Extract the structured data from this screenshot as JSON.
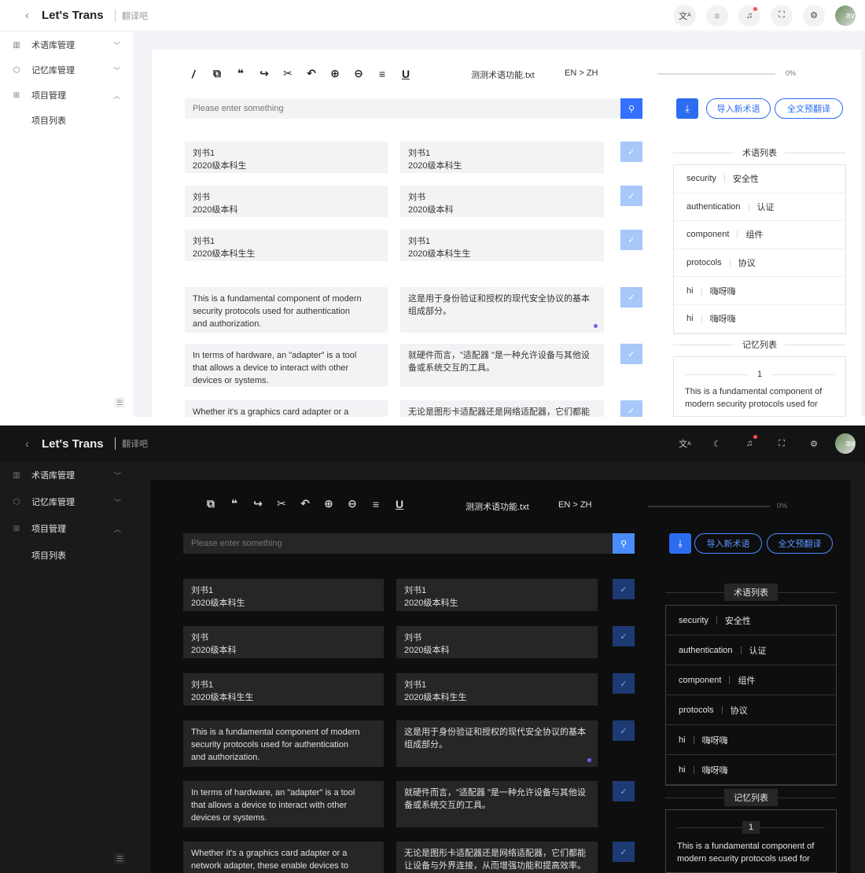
{
  "app": {
    "title": "Let's Trans",
    "subtitle": "翻译吧"
  },
  "header_icons": [
    "translate-icon",
    "theme-icon",
    "bell-icon",
    "fullscreen-icon",
    "settings-icon"
  ],
  "avatar_text": "av",
  "sidebar": {
    "items": [
      {
        "label": "术语库管理",
        "icon": "book-icon",
        "expanded": false
      },
      {
        "label": "记忆库管理",
        "icon": "cube-icon",
        "expanded": false
      },
      {
        "label": "项目管理",
        "icon": "grid-icon",
        "expanded": true
      }
    ],
    "subitems": [
      {
        "label": "项目列表"
      }
    ]
  },
  "toolbar": {
    "tools": [
      "italic-icon",
      "copy-icon",
      "quote-icon",
      "redo-icon",
      "cut-icon",
      "undo-icon",
      "zoom-in-icon",
      "zoom-out-icon",
      "align-icon",
      "underline-icon"
    ],
    "filename": "测测术语功能.txt",
    "lang": "EN > ZH",
    "progress": 0,
    "progress_label": "0%"
  },
  "search": {
    "placeholder": "Please enter something"
  },
  "actions": {
    "import_terms": "导入新术语",
    "pretranslate": "全文预翻译"
  },
  "segments": [
    {
      "source": [
        "刘书1",
        "2020级本科生"
      ],
      "target": [
        "刘书1",
        "2020级本科生"
      ],
      "marker": false
    },
    {
      "source": [
        "刘书",
        "2020级本科"
      ],
      "target": [
        "刘书",
        "2020级本科"
      ],
      "marker": false
    },
    {
      "source": [
        "刘书1",
        "2020级本科生生"
      ],
      "target": [
        "刘书1",
        "2020级本科生生"
      ],
      "marker": false
    },
    {
      "source": [
        "This is a fundamental component of modern",
        "security protocols used for authentication",
        "and authorization."
      ],
      "target": [
        "这是用于身份验证和授权的现代安全协议的基本",
        "组成部分。"
      ],
      "marker": true
    },
    {
      "source": [
        "In terms of hardware, an \"adapter\" is a tool",
        "that allows a device to interact with other",
        "devices or systems."
      ],
      "target": [
        "就硬件而言，\"适配器 \"是一种允许设备与其他设",
        "备或系统交互的工具。"
      ],
      "marker": false
    },
    {
      "source": [
        "Whether it's a graphics card adapter or a",
        "network adapter, these enable devices to"
      ],
      "target": [
        "无论是图形卡适配器还是网络适配器，它们都能",
        "让设备与外界连接，从而增强功能和提高效率。"
      ],
      "marker": false
    }
  ],
  "terms_title": "术语列表",
  "terms": [
    {
      "src": "security",
      "tgt": "安全性"
    },
    {
      "src": "authentication",
      "tgt": "认证"
    },
    {
      "src": "component",
      "tgt": "组件"
    },
    {
      "src": "protocols",
      "tgt": "协议"
    },
    {
      "src": "hi",
      "tgt": "嗨呀嗨"
    },
    {
      "src": "hi",
      "tgt": "嗨呀嗨"
    }
  ],
  "memory_title": "记忆列表",
  "memory": [
    {
      "index": "1",
      "lines": [
        "This is a fundamental component of",
        "modern security protocols used for"
      ]
    }
  ],
  "themes": {
    "light": {
      "accent": "#2c6df0",
      "check_bg": "#a7c8f8",
      "marker": "#7b5cf5"
    },
    "dark": {
      "accent": "#4a8cff",
      "check_bg": "#1e3a73",
      "marker": "#7b5cf5"
    }
  }
}
